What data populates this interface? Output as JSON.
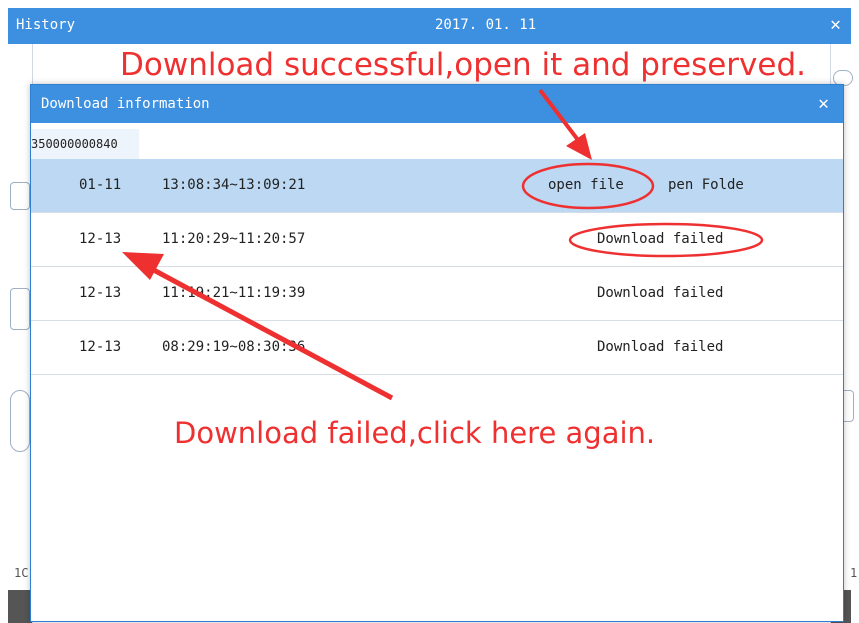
{
  "outer_window": {
    "title": "History",
    "date": "2017. 01. 11",
    "close_glyph": "✕",
    "left_edge_number": "1C",
    "right_edge_number": "1"
  },
  "dialog": {
    "title": "Download information",
    "close_glyph": "✕",
    "tab_label": "350000000840"
  },
  "rows": [
    {
      "date": "01-11",
      "time": "13:08:34~13:09:21",
      "action": "open file",
      "folder": "pen Folde",
      "selected": true
    },
    {
      "date": "12-13",
      "time": "11:20:29~11:20:57",
      "status": "Download failed"
    },
    {
      "date": "12-13",
      "time": "11:19:21~11:19:39",
      "status": "Download failed"
    },
    {
      "date": "12-13",
      "time": "08:29:19~08:30:36",
      "status": "Download failed"
    }
  ],
  "annotations": {
    "top": "Download successful,open it and preserved.",
    "bottom": "Download failed,click here again."
  },
  "colors": {
    "title_bar": "#3d8fe0",
    "selected_row": "#bcd8f3",
    "annotation": "#ee3030"
  }
}
